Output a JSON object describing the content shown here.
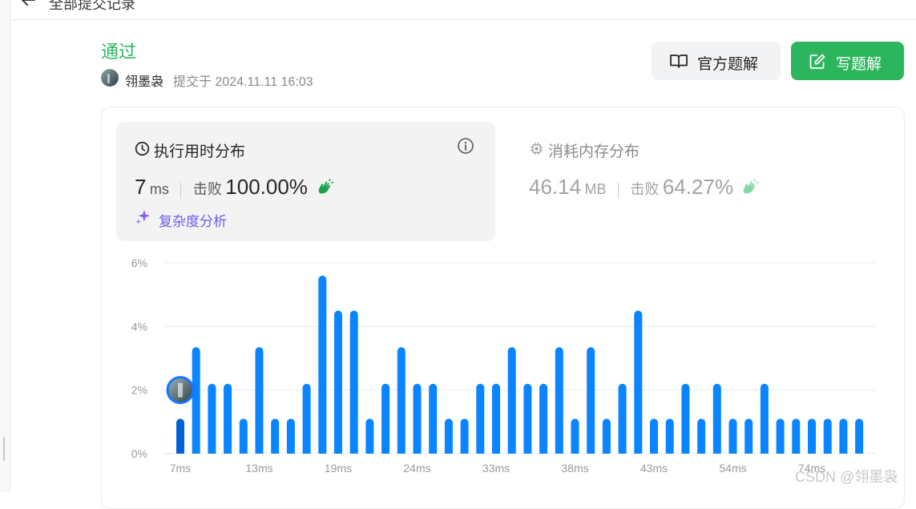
{
  "header": {
    "back_icon": "arrow-left-icon",
    "title": "全部提交记录"
  },
  "submission": {
    "status": "通过",
    "status_color": "#2db55d",
    "author": "翎墨袅",
    "submitted_at": "提交于 2024.11.11 16:03"
  },
  "actions": {
    "solution_label": "官方题解",
    "solution_icon": "book-open-icon",
    "write_label": "写题解",
    "write_icon": "edit-icon",
    "accent": "#2db55d"
  },
  "runtime": {
    "title": "执行用时分布",
    "icon": "clock-icon",
    "value": "7",
    "unit": "ms",
    "beat_label": "击败",
    "beat_value": "100.00%",
    "complexity_label": "复杂度分析",
    "complexity_icon": "sparkle-icon"
  },
  "memory": {
    "title": "消耗内存分布",
    "icon": "chip-icon",
    "value": "46.14",
    "unit": "MB",
    "beat_label": "击败",
    "beat_value": "64.27%"
  },
  "chart_data": {
    "type": "bar",
    "ylim": [
      0,
      6
    ],
    "yticks": [
      "0%",
      "2%",
      "4%",
      "6%"
    ],
    "xtick_labels": [
      "7ms",
      "13ms",
      "19ms",
      "24ms",
      "33ms",
      "38ms",
      "43ms",
      "54ms",
      "74ms"
    ],
    "xtick_bar_index": [
      0,
      5,
      10,
      15,
      20,
      25,
      30,
      35,
      40
    ],
    "values": [
      1.1,
      3.35,
      2.2,
      2.2,
      1.1,
      3.35,
      1.1,
      1.1,
      2.2,
      5.6,
      4.5,
      4.5,
      1.1,
      2.2,
      3.35,
      2.2,
      2.2,
      1.1,
      1.1,
      2.2,
      2.2,
      3.35,
      2.2,
      2.2,
      3.35,
      1.1,
      3.35,
      1.1,
      2.2,
      4.5,
      1.1,
      1.1,
      2.2,
      1.1,
      2.2,
      1.1,
      1.1,
      2.2,
      1.1,
      1.1,
      1.1,
      1.1,
      1.1,
      1.1
    ],
    "bar_color": "#0a84ff",
    "highlight_bar_index": 0,
    "highlight_marker": {
      "bar_index": 0,
      "value": 2.0
    },
    "grid": true
  },
  "watermark": "CSDN @翎墨袅"
}
